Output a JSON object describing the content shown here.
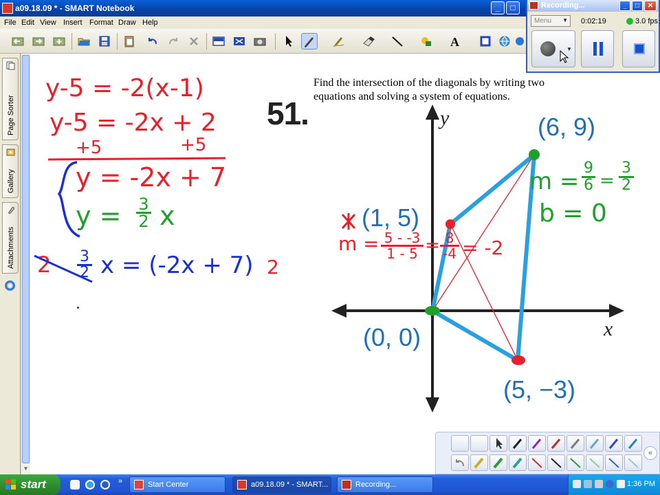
{
  "window": {
    "title": "a09.18.09 * - SMART Notebook"
  },
  "menu": [
    "File",
    "Edit",
    "View",
    "Insert",
    "Format",
    "Draw",
    "Help"
  ],
  "side_tabs": [
    "Page Sorter",
    "Gallery",
    "Attachments"
  ],
  "problem": {
    "number": "51.",
    "text": "Find the intersection of the diagonals by writing two equations and solving a system of equations."
  },
  "graph": {
    "axis_x": "x",
    "axis_y": "y",
    "points": [
      {
        "label": "(6, 9)",
        "x": 6,
        "y": 9
      },
      {
        "label": "(1, 5)",
        "x": 1,
        "y": 5
      },
      {
        "label": "(0, 0)",
        "x": 0,
        "y": 0
      },
      {
        "label": "(5, −3)",
        "x": 5,
        "y": -3
      }
    ]
  },
  "handwriting": {
    "line1": "y-5 = -2(x-1)",
    "line2": "y-5 = -2x + 2",
    "line3_left": "+5",
    "line3_right": "+5",
    "eq1": "y = -2x + 7",
    "eq2_lhs": "y =",
    "eq2_frac_num": "3",
    "eq2_frac_den": "2",
    "eq2_rhs": "x",
    "solve_lead": "2",
    "solve_frac_num": "3",
    "solve_frac_den": "2",
    "solve_mid": "x = (-2x + 7)",
    "solve_tail": "2",
    "slope_red_prefix": "m =",
    "slope_red_num": "5 - -3",
    "slope_red_den": "1 - 5",
    "slope_red_eq": "=",
    "slope_red_num2": "8",
    "slope_red_den2": "-4",
    "slope_red_result": "= -2",
    "slope_green_prefix": "m =",
    "slope_green_num": "9",
    "slope_green_den": "6",
    "slope_green_eq": "=",
    "slope_green_num2": "3",
    "slope_green_den2": "2",
    "intercept_green": "b = 0"
  },
  "recording": {
    "title": "Recording...",
    "menu_label": "Menu",
    "time": "0:02:19",
    "fps": "3.0 fps"
  },
  "taskbar": {
    "start": "start",
    "items": [
      "Start Center",
      "a09.18.09 * - SMART...",
      "Recording..."
    ],
    "clock": "1:36 PM"
  },
  "colors": {
    "titlebar": "#0a5fd8",
    "ink_red": "#e8202a",
    "ink_blue": "#1a2fd6",
    "ink_green": "#1ea02a",
    "shape_blue": "#2aa0e0",
    "taskbar": "#245edb",
    "start_green": "#2d8a2d"
  }
}
